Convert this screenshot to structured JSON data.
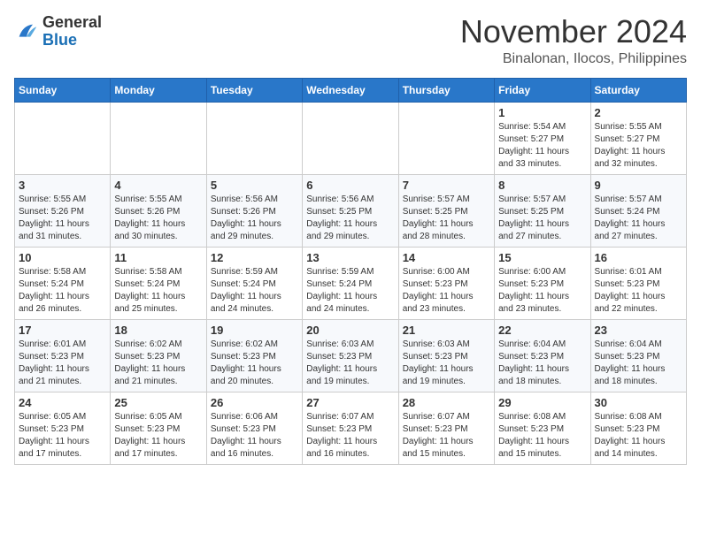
{
  "header": {
    "logo": {
      "general": "General",
      "blue": "Blue"
    },
    "title": "November 2024",
    "subtitle": "Binalonan, Ilocos, Philippines"
  },
  "weekdays": [
    "Sunday",
    "Monday",
    "Tuesday",
    "Wednesday",
    "Thursday",
    "Friday",
    "Saturday"
  ],
  "weeks": [
    [
      {
        "day": "",
        "info": ""
      },
      {
        "day": "",
        "info": ""
      },
      {
        "day": "",
        "info": ""
      },
      {
        "day": "",
        "info": ""
      },
      {
        "day": "",
        "info": ""
      },
      {
        "day": "1",
        "info": "Sunrise: 5:54 AM\nSunset: 5:27 PM\nDaylight: 11 hours\nand 33 minutes."
      },
      {
        "day": "2",
        "info": "Sunrise: 5:55 AM\nSunset: 5:27 PM\nDaylight: 11 hours\nand 32 minutes."
      }
    ],
    [
      {
        "day": "3",
        "info": "Sunrise: 5:55 AM\nSunset: 5:26 PM\nDaylight: 11 hours\nand 31 minutes."
      },
      {
        "day": "4",
        "info": "Sunrise: 5:55 AM\nSunset: 5:26 PM\nDaylight: 11 hours\nand 30 minutes."
      },
      {
        "day": "5",
        "info": "Sunrise: 5:56 AM\nSunset: 5:26 PM\nDaylight: 11 hours\nand 29 minutes."
      },
      {
        "day": "6",
        "info": "Sunrise: 5:56 AM\nSunset: 5:25 PM\nDaylight: 11 hours\nand 29 minutes."
      },
      {
        "day": "7",
        "info": "Sunrise: 5:57 AM\nSunset: 5:25 PM\nDaylight: 11 hours\nand 28 minutes."
      },
      {
        "day": "8",
        "info": "Sunrise: 5:57 AM\nSunset: 5:25 PM\nDaylight: 11 hours\nand 27 minutes."
      },
      {
        "day": "9",
        "info": "Sunrise: 5:57 AM\nSunset: 5:24 PM\nDaylight: 11 hours\nand 27 minutes."
      }
    ],
    [
      {
        "day": "10",
        "info": "Sunrise: 5:58 AM\nSunset: 5:24 PM\nDaylight: 11 hours\nand 26 minutes."
      },
      {
        "day": "11",
        "info": "Sunrise: 5:58 AM\nSunset: 5:24 PM\nDaylight: 11 hours\nand 25 minutes."
      },
      {
        "day": "12",
        "info": "Sunrise: 5:59 AM\nSunset: 5:24 PM\nDaylight: 11 hours\nand 24 minutes."
      },
      {
        "day": "13",
        "info": "Sunrise: 5:59 AM\nSunset: 5:24 PM\nDaylight: 11 hours\nand 24 minutes."
      },
      {
        "day": "14",
        "info": "Sunrise: 6:00 AM\nSunset: 5:23 PM\nDaylight: 11 hours\nand 23 minutes."
      },
      {
        "day": "15",
        "info": "Sunrise: 6:00 AM\nSunset: 5:23 PM\nDaylight: 11 hours\nand 23 minutes."
      },
      {
        "day": "16",
        "info": "Sunrise: 6:01 AM\nSunset: 5:23 PM\nDaylight: 11 hours\nand 22 minutes."
      }
    ],
    [
      {
        "day": "17",
        "info": "Sunrise: 6:01 AM\nSunset: 5:23 PM\nDaylight: 11 hours\nand 21 minutes."
      },
      {
        "day": "18",
        "info": "Sunrise: 6:02 AM\nSunset: 5:23 PM\nDaylight: 11 hours\nand 21 minutes."
      },
      {
        "day": "19",
        "info": "Sunrise: 6:02 AM\nSunset: 5:23 PM\nDaylight: 11 hours\nand 20 minutes."
      },
      {
        "day": "20",
        "info": "Sunrise: 6:03 AM\nSunset: 5:23 PM\nDaylight: 11 hours\nand 19 minutes."
      },
      {
        "day": "21",
        "info": "Sunrise: 6:03 AM\nSunset: 5:23 PM\nDaylight: 11 hours\nand 19 minutes."
      },
      {
        "day": "22",
        "info": "Sunrise: 6:04 AM\nSunset: 5:23 PM\nDaylight: 11 hours\nand 18 minutes."
      },
      {
        "day": "23",
        "info": "Sunrise: 6:04 AM\nSunset: 5:23 PM\nDaylight: 11 hours\nand 18 minutes."
      }
    ],
    [
      {
        "day": "24",
        "info": "Sunrise: 6:05 AM\nSunset: 5:23 PM\nDaylight: 11 hours\nand 17 minutes."
      },
      {
        "day": "25",
        "info": "Sunrise: 6:05 AM\nSunset: 5:23 PM\nDaylight: 11 hours\nand 17 minutes."
      },
      {
        "day": "26",
        "info": "Sunrise: 6:06 AM\nSunset: 5:23 PM\nDaylight: 11 hours\nand 16 minutes."
      },
      {
        "day": "27",
        "info": "Sunrise: 6:07 AM\nSunset: 5:23 PM\nDaylight: 11 hours\nand 16 minutes."
      },
      {
        "day": "28",
        "info": "Sunrise: 6:07 AM\nSunset: 5:23 PM\nDaylight: 11 hours\nand 15 minutes."
      },
      {
        "day": "29",
        "info": "Sunrise: 6:08 AM\nSunset: 5:23 PM\nDaylight: 11 hours\nand 15 minutes."
      },
      {
        "day": "30",
        "info": "Sunrise: 6:08 AM\nSunset: 5:23 PM\nDaylight: 11 hours\nand 14 minutes."
      }
    ]
  ]
}
